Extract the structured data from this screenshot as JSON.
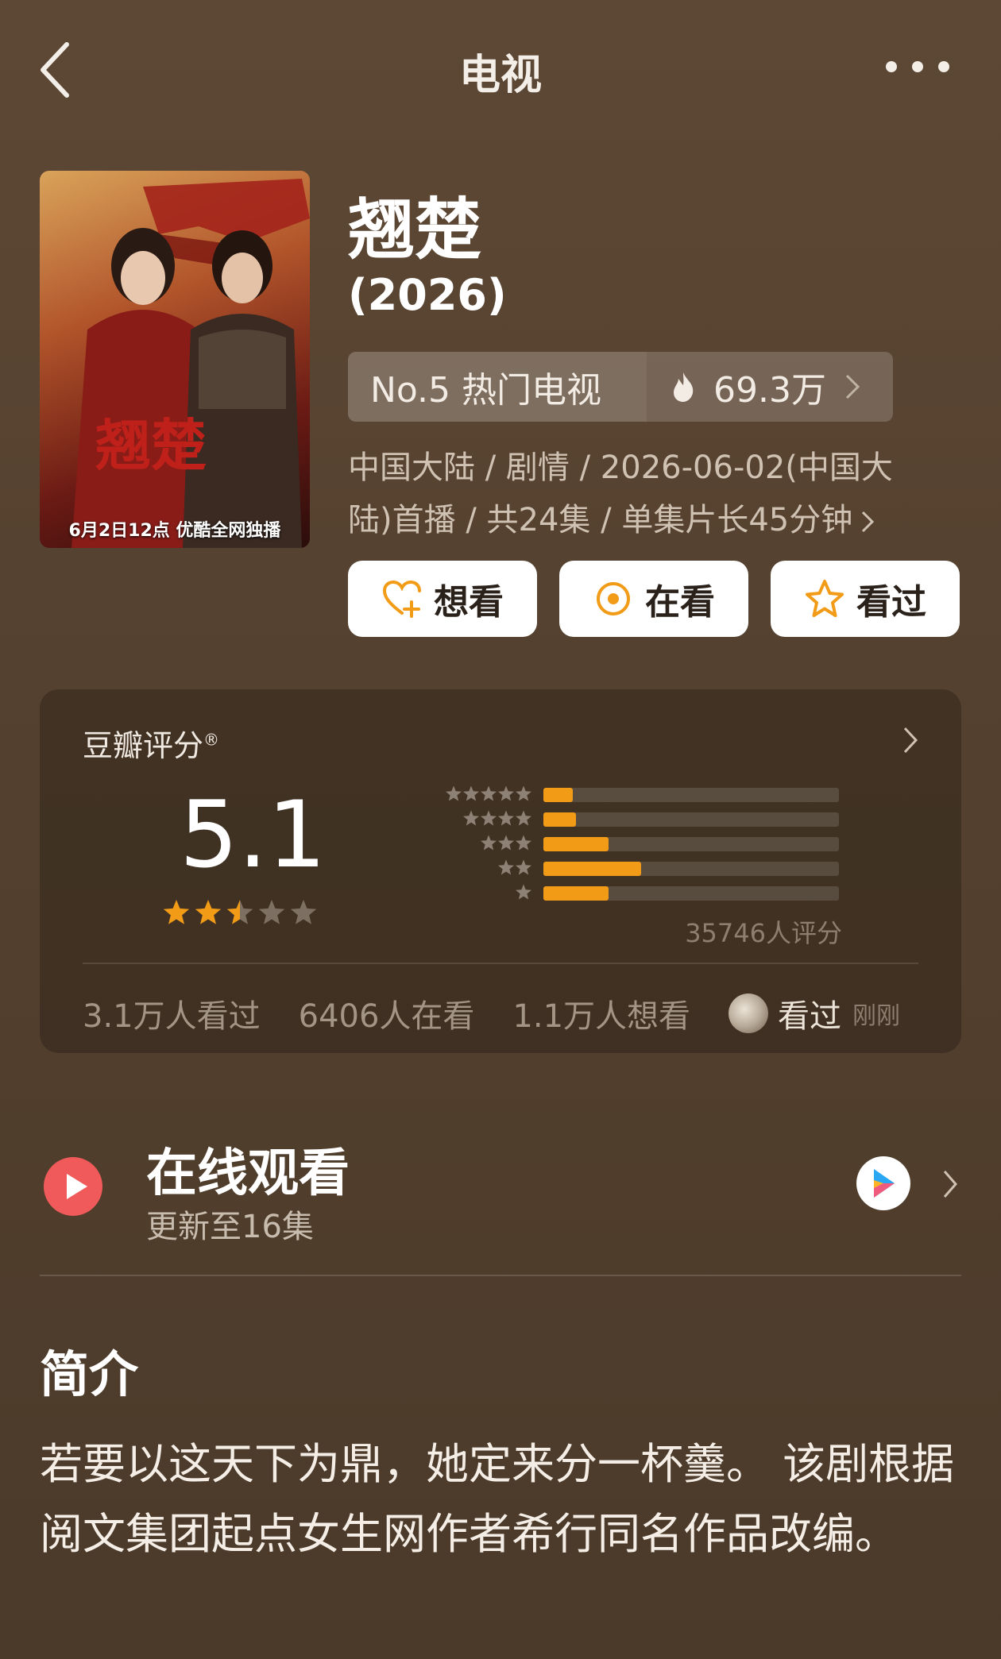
{
  "nav": {
    "title": "电视"
  },
  "poster": {
    "caption": "6月2日12点 优酷全网独播"
  },
  "show": {
    "title": "翘楚",
    "year": "(2026)"
  },
  "rank": {
    "label": "No.5 热门电视",
    "heat": "69.3万"
  },
  "meta": {
    "line1": "中国大陆 / 剧情 / 2026-06-02(中国大",
    "line2": "陆)首播 / 共24集 / 单集片长45分钟"
  },
  "actions": {
    "want": "想看",
    "watching": "在看",
    "watched": "看过"
  },
  "rating": {
    "label": "豆瓣评分",
    "score": "5.1",
    "stars": 2.5,
    "distribution": [
      {
        "stars": 5,
        "fraction": 0.1
      },
      {
        "stars": 4,
        "fraction": 0.11
      },
      {
        "stars": 3,
        "fraction": 0.22
      },
      {
        "stars": 2,
        "fraction": 0.33
      },
      {
        "stars": 1,
        "fraction": 0.22
      }
    ],
    "count": "35746人评分",
    "watched_count": "3.1万人看过",
    "watching_count": "6406人在看",
    "want_count": "1.1万人想看",
    "friend_action": "看过",
    "friend_time": "刚刚"
  },
  "online": {
    "title": "在线观看",
    "subtitle": "更新至16集"
  },
  "intro": {
    "heading": "简介",
    "body": "若要以这天下为鼎，她定来分一杯羹。 该剧根据阅文集团起点女生网作者希行同名作品改编。"
  },
  "colors": {
    "accent": "#f29b17",
    "play_red": "#f15a5a",
    "background": "#54412f"
  }
}
